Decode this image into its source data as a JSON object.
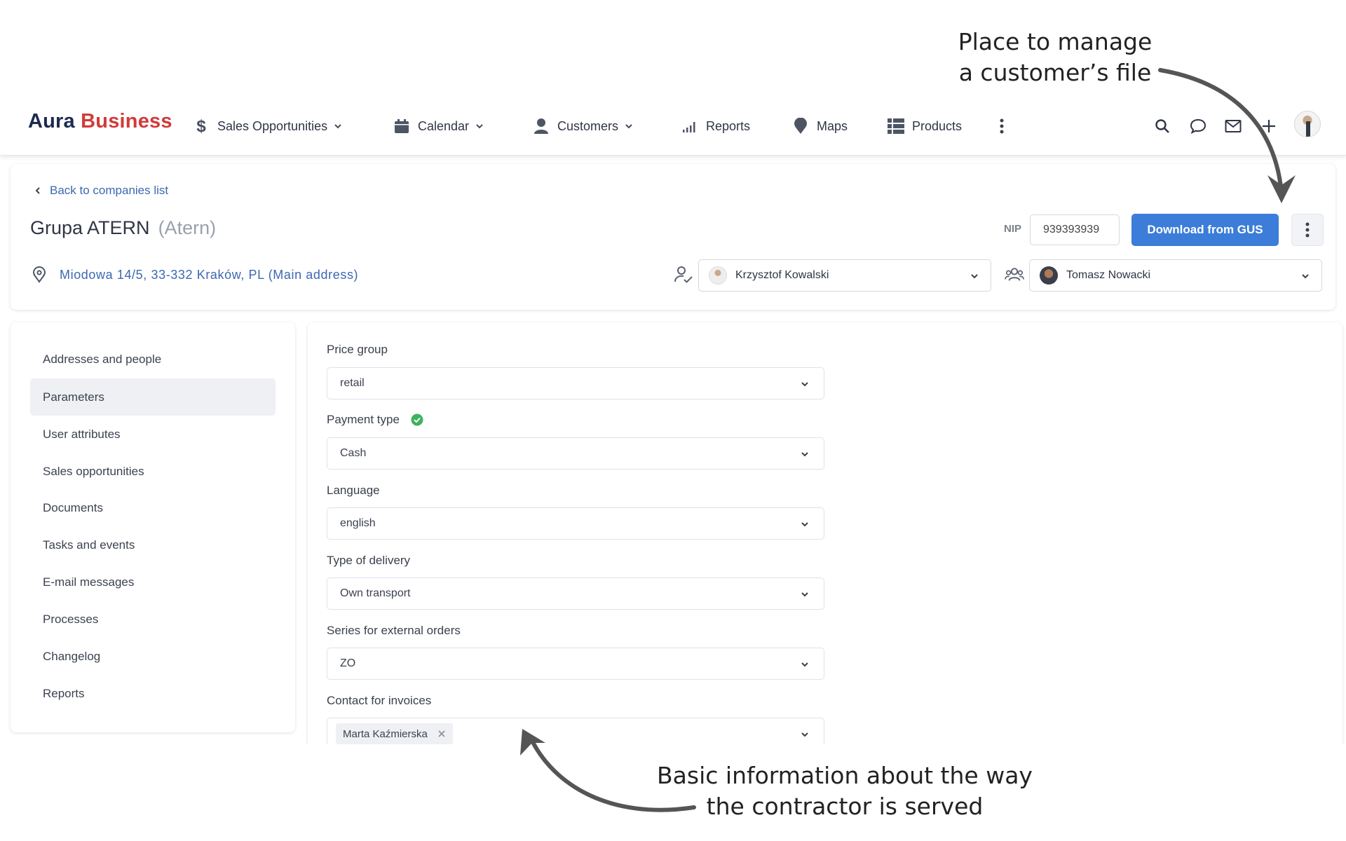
{
  "annotations": {
    "top_line1": "Place to manage",
    "top_line2": "a customer’s file",
    "bottom_line1": "Basic information about the way",
    "bottom_line2": "the contractor is served"
  },
  "navbar": {
    "logo_part1": "Aura",
    "logo_part2": "Business",
    "items": [
      {
        "label": "Sales Opportunities",
        "icon": "dollar-icon",
        "dropdown": true
      },
      {
        "label": "Calendar",
        "icon": "calendar-icon",
        "dropdown": true
      },
      {
        "label": "Customers",
        "icon": "person-icon",
        "dropdown": true
      },
      {
        "label": "Reports",
        "icon": "bar-chart-icon",
        "dropdown": false
      },
      {
        "label": "Maps",
        "icon": "map-pin-icon",
        "dropdown": false
      },
      {
        "label": "Products",
        "icon": "grid-list-icon",
        "dropdown": false
      }
    ],
    "right_icons": [
      "search-icon",
      "chat-icon",
      "mail-icon",
      "plus-icon"
    ]
  },
  "header": {
    "back_label": "Back to companies list",
    "company_name": "Grupa ATERN",
    "company_short": "(Atern)",
    "address": "Miodowa 14/5, 33-332 Kraków, PL (Main address)",
    "nip_label": "NIP",
    "nip_value": "939393939",
    "gus_button": "Download from GUS",
    "owner": "Krzysztof Kowalski",
    "team_member": "Tomasz Nowacki"
  },
  "sidebar": {
    "items": [
      {
        "label": "Addresses and people",
        "active": false
      },
      {
        "label": "Parameters",
        "active": true
      },
      {
        "label": "User attributes",
        "active": false
      },
      {
        "label": "Sales opportunities",
        "active": false
      },
      {
        "label": "Documents",
        "active": false
      },
      {
        "label": "Tasks and events",
        "active": false
      },
      {
        "label": "E-mail messages",
        "active": false
      },
      {
        "label": "Processes",
        "active": false
      },
      {
        "label": "Changelog",
        "active": false
      },
      {
        "label": "Reports",
        "active": false
      }
    ]
  },
  "form": {
    "fields": [
      {
        "label": "Price group",
        "value": "retail",
        "verified": false
      },
      {
        "label": "Payment type",
        "value": "Cash",
        "verified": true
      },
      {
        "label": "Language",
        "value": "english",
        "verified": false
      },
      {
        "label": "Type of delivery",
        "value": "Own transport",
        "verified": false
      },
      {
        "label": "Series for external orders",
        "value": "ZO",
        "verified": false
      },
      {
        "label": "Contact for invoices",
        "tag": "Marta Kaźmierska",
        "verified": false
      }
    ]
  },
  "colors": {
    "accent": "#3b7dd8",
    "link": "#3d68b0",
    "logo_dark": "#1d2a50",
    "logo_red": "#d23a38",
    "verified_green": "#3fb15f"
  }
}
